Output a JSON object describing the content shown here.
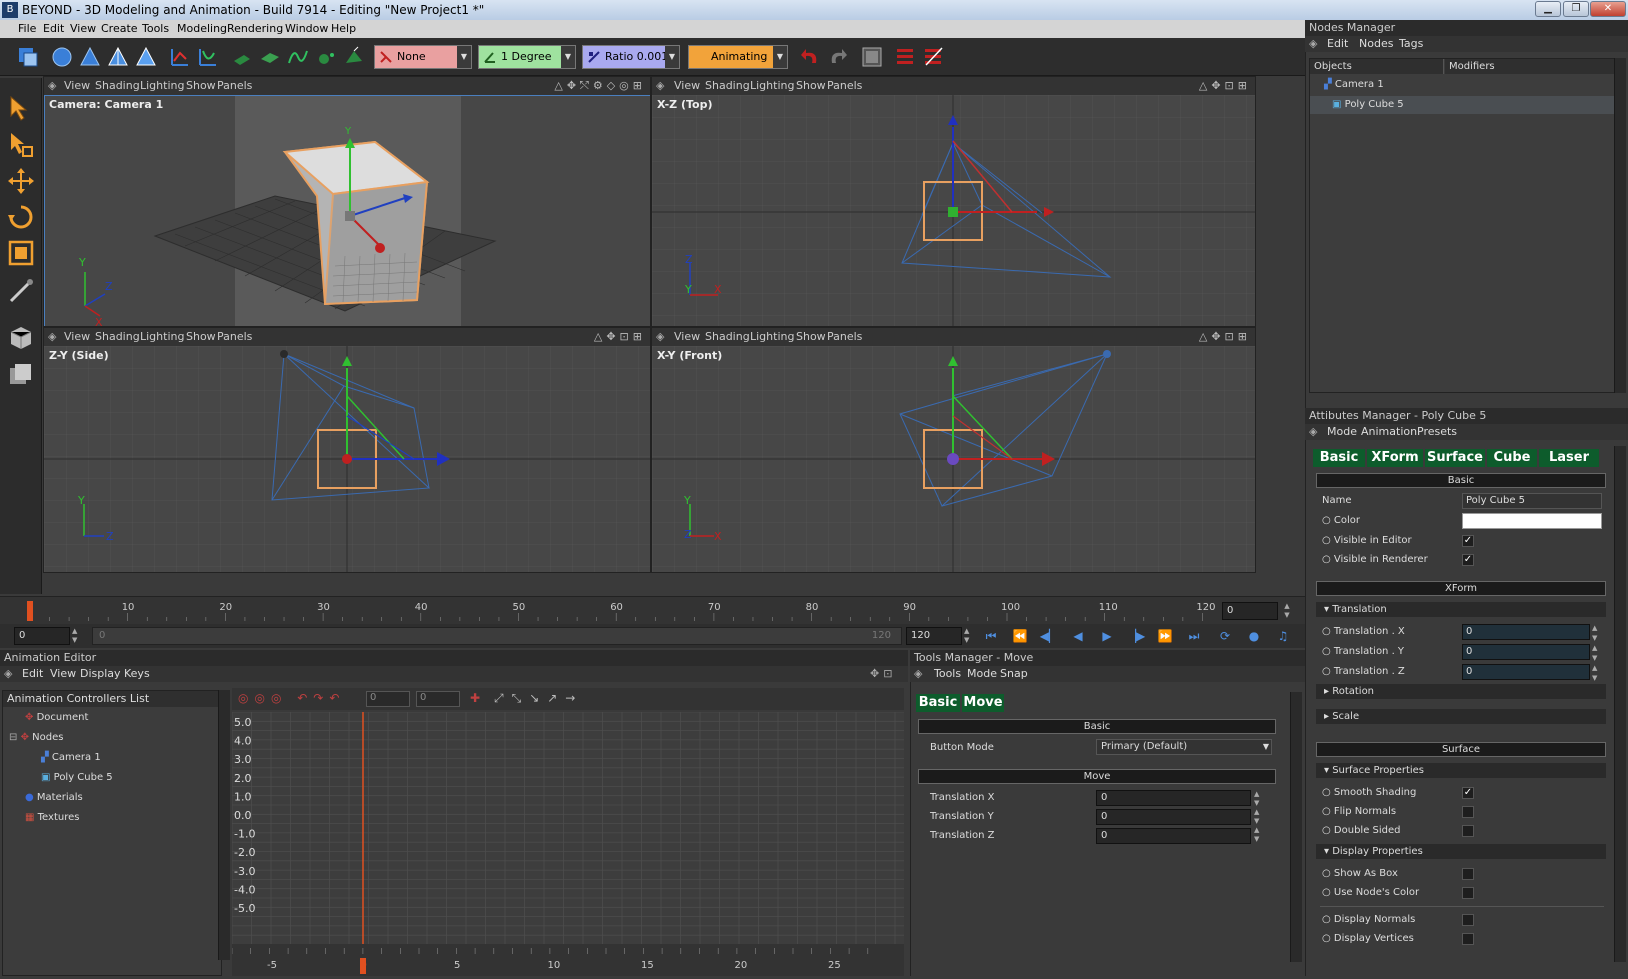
{
  "window": {
    "title": "BEYOND - 3D Modeling and Animation - Build 7914 - Editing \"New Project1 *\""
  },
  "menu": [
    "File",
    "Edit",
    "View",
    "Create",
    "Tools",
    "Modeling",
    "Rendering",
    "Window",
    "Help"
  ],
  "toolbar": {
    "snap_mode": "None",
    "angle": "1 Degree",
    "ratio": "Ratio 0.001",
    "anim_mode": "Animating"
  },
  "viewports": [
    {
      "menus": [
        "View",
        "Shading",
        "Lighting",
        "Show",
        "Panels"
      ],
      "label": "Camera: Camera 1"
    },
    {
      "menus": [
        "View",
        "Shading",
        "Lighting",
        "Show",
        "Panels"
      ],
      "label": "X-Z (Top)"
    },
    {
      "menus": [
        "View",
        "Shading",
        "Lighting",
        "Show",
        "Panels"
      ],
      "label": "Z-Y (Side)"
    },
    {
      "menus": [
        "View",
        "Shading",
        "Lighting",
        "Show",
        "Panels"
      ],
      "label": "X-Y (Front)"
    }
  ],
  "axis_letters": {
    "x": "X",
    "y": "Y",
    "z": "Z"
  },
  "timeline": {
    "ticks": [
      "10",
      "20",
      "30",
      "40",
      "50",
      "60",
      "70",
      "80",
      "90",
      "100",
      "110",
      "120"
    ],
    "current_frame": "0",
    "start_field": "0",
    "range_start": "0",
    "range_end": "120",
    "end_field": "120"
  },
  "nodes_manager": {
    "title": "Nodes Manager",
    "menus": [
      "Edit",
      "Nodes",
      "Tags"
    ],
    "columns": [
      "Objects",
      "Modifiers"
    ],
    "items": [
      "Camera 1",
      "Poly Cube 5"
    ]
  },
  "attributes_manager": {
    "title": "Attibutes Manager - Poly Cube 5",
    "menus": [
      "Mode",
      "Animation",
      "Presets"
    ],
    "tabs": [
      "Basic",
      "XForm",
      "Surface",
      "Cube",
      "Laser"
    ],
    "basic": {
      "header": "Basic",
      "name_label": "Name",
      "name_value": "Poly Cube 5",
      "color_label": "Color",
      "visible_editor_label": "Visible in Editor",
      "visible_editor": true,
      "visible_renderer_label": "Visible in Renderer",
      "visible_renderer": true
    },
    "xform": {
      "header": "XForm",
      "translation_header": "Translation",
      "tx_label": "Translation . X",
      "tx": "0",
      "ty_label": "Translation . Y",
      "ty": "0",
      "tz_label": "Translation . Z",
      "tz": "0",
      "rotation_header": "Rotation",
      "scale_header": "Scale"
    },
    "surface": {
      "header": "Surface",
      "surface_props_header": "Surface Properties",
      "smooth_label": "Smooth Shading",
      "smooth": true,
      "flip_label": "Flip Normals",
      "flip": false,
      "double_label": "Double Sided",
      "double": false,
      "display_props_header": "Display Properties",
      "box_label": "Show As Box",
      "box": false,
      "nodecolor_label": "Use Node's Color",
      "nodecolor": false,
      "normals_label": "Display Normals",
      "normals": false,
      "vertices_label": "Display Vertices",
      "vertices": false
    }
  },
  "animation_editor": {
    "title": "Animation Editor",
    "menus": [
      "Edit",
      "View",
      "Display",
      "Keys"
    ],
    "list_title": "Animation Controllers List",
    "tree": [
      "Document",
      "Nodes",
      "Camera 1",
      "Poly Cube 5",
      "Materials",
      "Textures"
    ],
    "key_field_1": "0",
    "key_field_2": "0",
    "y_ticks": [
      "5.0",
      "4.0",
      "3.0",
      "2.0",
      "1.0",
      "0.0",
      "-1.0",
      "-2.0",
      "-3.0",
      "-4.0",
      "-5.0"
    ],
    "x_ticks": [
      "-5",
      "0",
      "5",
      "10",
      "15",
      "20",
      "25"
    ]
  },
  "tools_manager": {
    "title": "Tools Manager - Move",
    "menus": [
      "Tools",
      "Mode",
      "Snap"
    ],
    "tabs": [
      "Basic",
      "Move"
    ],
    "basic_header": "Basic",
    "button_mode_label": "Button Mode",
    "button_mode_value": "Primary (Default)",
    "move_header": "Move",
    "tx_label": "Translation X",
    "tx": "0",
    "ty_label": "Translation Y",
    "ty": "0",
    "tz_label": "Translation Z",
    "tz": "0"
  },
  "colors": {
    "accent_green": "#0d5c2c",
    "selection_orange": "#e8a060",
    "playhead": "#e05020",
    "anim_field": "#f2a33a"
  }
}
